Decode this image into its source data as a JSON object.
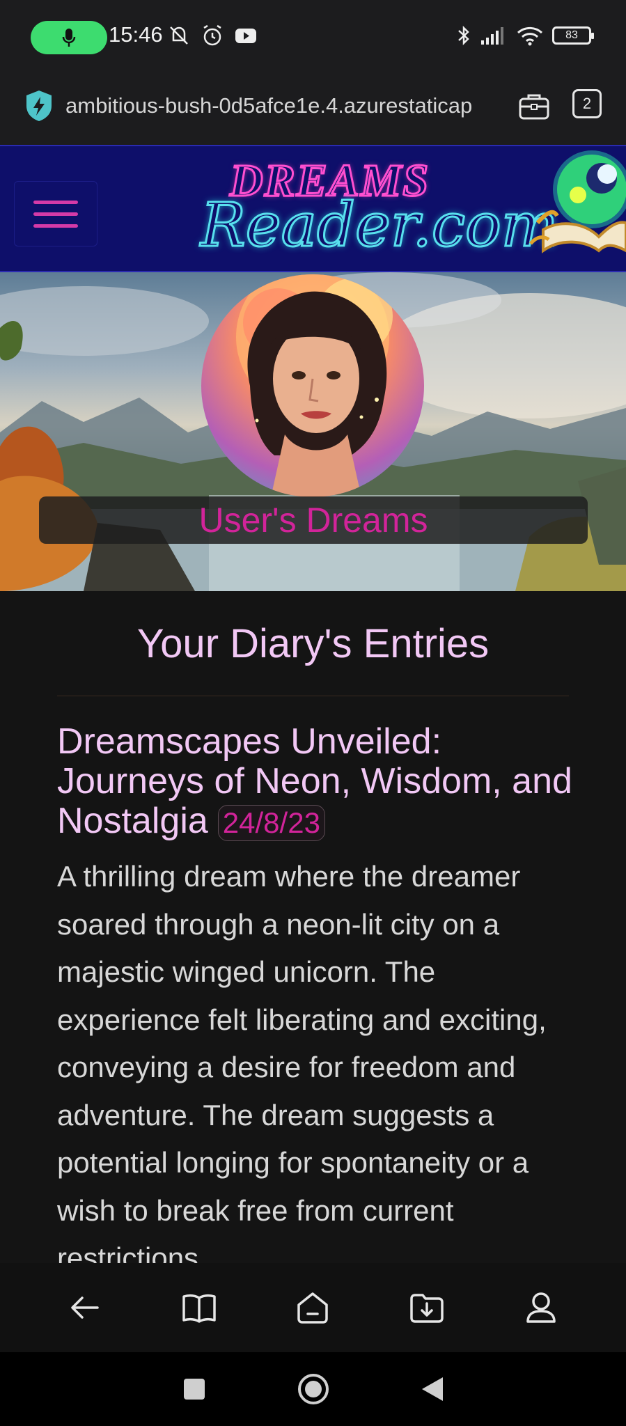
{
  "status_bar": {
    "time": "15:46",
    "battery": "83",
    "icons": [
      "mic-icon",
      "mute-icon",
      "alarm-icon",
      "youtube-icon",
      "bluetooth-icon",
      "signal-icon",
      "wifi-icon",
      "battery-icon"
    ]
  },
  "url_bar": {
    "url": "ambitious-bush-0d5afce1e.4.azurestaticap",
    "tab_count": "2"
  },
  "header": {
    "logo_top": "DREAMS",
    "logo_bottom": "Reader.com"
  },
  "hero": {
    "banner_text": "User's Dreams"
  },
  "diary": {
    "title": "Your Diary's Entries",
    "entries": [
      {
        "title": "Dreamscapes Unveiled: Journeys of Neon, Wisdom, and Nostalgia",
        "date": "24/8/23",
        "body": "A thrilling dream where the dreamer soared through a neon-lit city on a majestic winged unicorn. The experience felt liberating and exciting, conveying a desire for freedom and adventure. The dream suggests a potential longing for spontaneity or a wish to break free from current restrictions."
      }
    ]
  },
  "colors": {
    "accent_pink": "#d2249a",
    "title_lavender": "#f2c8f5",
    "header_navy": "#0e0f6a",
    "logo_cyan": "#58e0ee"
  }
}
